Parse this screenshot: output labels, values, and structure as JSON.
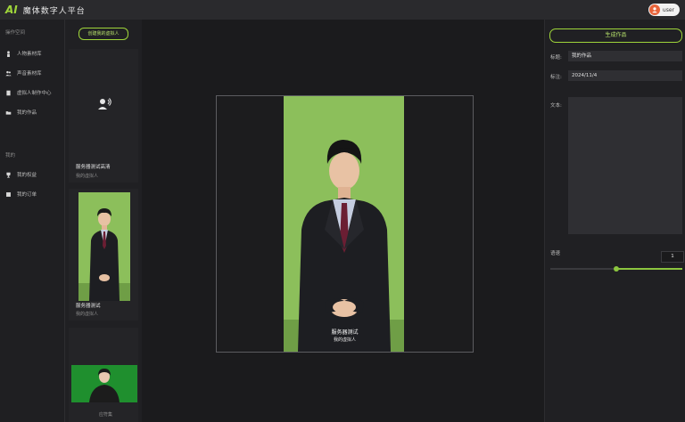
{
  "app": {
    "logo": "AI",
    "title": "魔体数字人平台",
    "user_name": "user",
    "accent_color": "#9fd53a"
  },
  "nav": {
    "section1": "操作空间",
    "items": [
      {
        "label": "人物素材库",
        "icon": "person-icon"
      },
      {
        "label": "声音素材库",
        "icon": "voice-users-icon"
      },
      {
        "label": "虚拟人制作中心",
        "icon": "file-icon"
      },
      {
        "label": "我的作品",
        "icon": "folder-icon"
      }
    ],
    "section2": "我的",
    "items2": [
      {
        "label": "我的权益",
        "icon": "trophy-icon"
      },
      {
        "label": "我的订单",
        "icon": "order-icon"
      }
    ]
  },
  "list": {
    "create_label": "创建我的虚拟人",
    "cards": [
      {
        "title": "服务器测试高清",
        "subtitle": "我的虚拟人"
      },
      {
        "title": "服务器测试",
        "subtitle": "我的虚拟人"
      },
      {
        "title": "",
        "subtitle": "应符集"
      }
    ]
  },
  "stage": {
    "title": "服务器测试",
    "subtitle": "我的虚拟人"
  },
  "panel": {
    "generate_label": "生成作品",
    "title_label": "标题:",
    "title_value": "我的作品",
    "note_label": "标注:",
    "note_value": "2024/11/4",
    "text_label": "文本:",
    "speed_label": "语速",
    "speed_value": "1",
    "speed_fraction": 0.5
  }
}
